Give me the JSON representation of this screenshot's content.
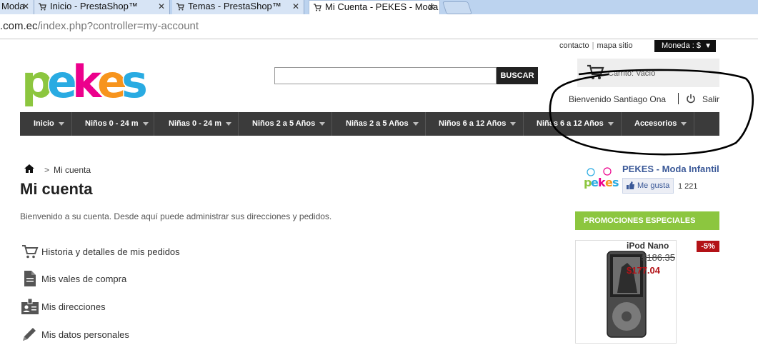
{
  "browser": {
    "tabs": [
      {
        "title": "Moda",
        "active": false
      },
      {
        "title": "Inicio - PrestaShop™",
        "active": false
      },
      {
        "title": "Temas - PrestaShop™",
        "active": false
      },
      {
        "title": "Mi Cuenta - PEKES - Moda",
        "active": true
      }
    ],
    "url_host": ".com.ec",
    "url_path": "/index.php?controller=my-account"
  },
  "header": {
    "contact_link": "contacto",
    "sitemap_link": "mapa sitio",
    "currency_label": "Moneda : $",
    "logo_text": "pekes",
    "search": {
      "placeholder": "",
      "button_label": "BUSCAR"
    },
    "cart_label": "Carrito: Vacío",
    "welcome_text": "Bienvenido Santiago Ona",
    "logout_label": "Salir"
  },
  "nav": {
    "items": [
      "Inicio",
      "Niños 0 - 24 m",
      "Niñas 0 - 24 m",
      "Niños 2 a 5 Años",
      "Niñas 2 a 5 Años",
      "Niños 6 a 12 Años",
      "Niñas 6 a 12 Años",
      "Accesorios"
    ]
  },
  "main": {
    "breadcrumb_current": "Mi cuenta",
    "breadcrumb_sep": ">",
    "title": "Mi cuenta",
    "intro": "Bienvenido a su cuenta. Desde aquí puede administrar sus direcciones y pedidos.",
    "account_links": [
      {
        "label": "Historia y detalles de mis pedidos",
        "icon": "cart-icon"
      },
      {
        "label": "Mis vales de compra",
        "icon": "document-icon"
      },
      {
        "label": "Mis direcciones",
        "icon": "address-card-icon"
      },
      {
        "label": "Mis datos personales",
        "icon": "pencil-icon"
      }
    ]
  },
  "sidebar": {
    "facebook": {
      "page_name": "PEKES - Moda Infantil",
      "like_label": "Me gusta",
      "like_count": "1 221"
    },
    "promo": {
      "heading": "PROMOCIONES ESPECIALES",
      "product_name": "iPod Nano",
      "old_price": "$186.35",
      "new_price": "$177.04",
      "discount": "-5%"
    }
  },
  "colors": {
    "nav_bg": "#3b3b3b",
    "promo_green": "#8cc63f",
    "price_red": "#b31217",
    "fb_blue": "#3b5998"
  }
}
